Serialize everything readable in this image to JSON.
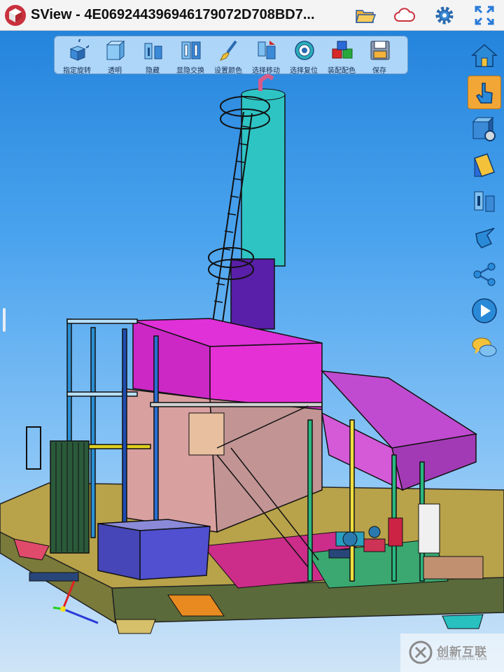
{
  "app": {
    "title": "SView - 4E069244396946179072D708BD7..."
  },
  "header_icons": [
    "sview-logo-icon",
    "open-folder-icon",
    "cloud-icon",
    "settings-gear-icon",
    "fullscreen-icon"
  ],
  "toolbar": {
    "tools": [
      {
        "label": "指定旋转",
        "icon": "rotate-cube-icon"
      },
      {
        "label": "透明",
        "icon": "transparent-cube-icon"
      },
      {
        "label": "隐藏",
        "icon": "hide-parts-icon"
      },
      {
        "label": "显隐交换",
        "icon": "swap-visibility-icon"
      },
      {
        "label": "设置颜色",
        "icon": "paint-brush-icon"
      },
      {
        "label": "选择移动",
        "icon": "move-parts-icon"
      },
      {
        "label": "选择复位",
        "icon": "reset-target-icon"
      },
      {
        "label": "装配配色",
        "icon": "assembly-color-icon"
      },
      {
        "label": "保存",
        "icon": "save-disk-icon"
      }
    ]
  },
  "sidebar": {
    "items": [
      {
        "name": "home",
        "icon": "home-icon",
        "active": false
      },
      {
        "name": "touch",
        "icon": "hand-pointer-icon",
        "active": true
      },
      {
        "name": "view-settings",
        "icon": "cube-gear-icon",
        "active": false
      },
      {
        "name": "section",
        "icon": "section-plane-icon",
        "active": false
      },
      {
        "name": "explode",
        "icon": "explode-parts-icon",
        "active": false
      },
      {
        "name": "gesture",
        "icon": "gesture-hand-icon",
        "active": false
      },
      {
        "name": "share",
        "icon": "share-icon",
        "active": false
      },
      {
        "name": "play",
        "icon": "play-icon",
        "active": false
      },
      {
        "name": "annotation",
        "icon": "chat-bubble-icon",
        "active": false
      }
    ]
  },
  "colors": {
    "accent_active": "#f2a636",
    "background_top": "#1e7fd9",
    "background_bottom": "#cfe4f7"
  },
  "watermark": {
    "text": "创新互联",
    "subtext": "CHUANG XIN HU LIAN"
  }
}
